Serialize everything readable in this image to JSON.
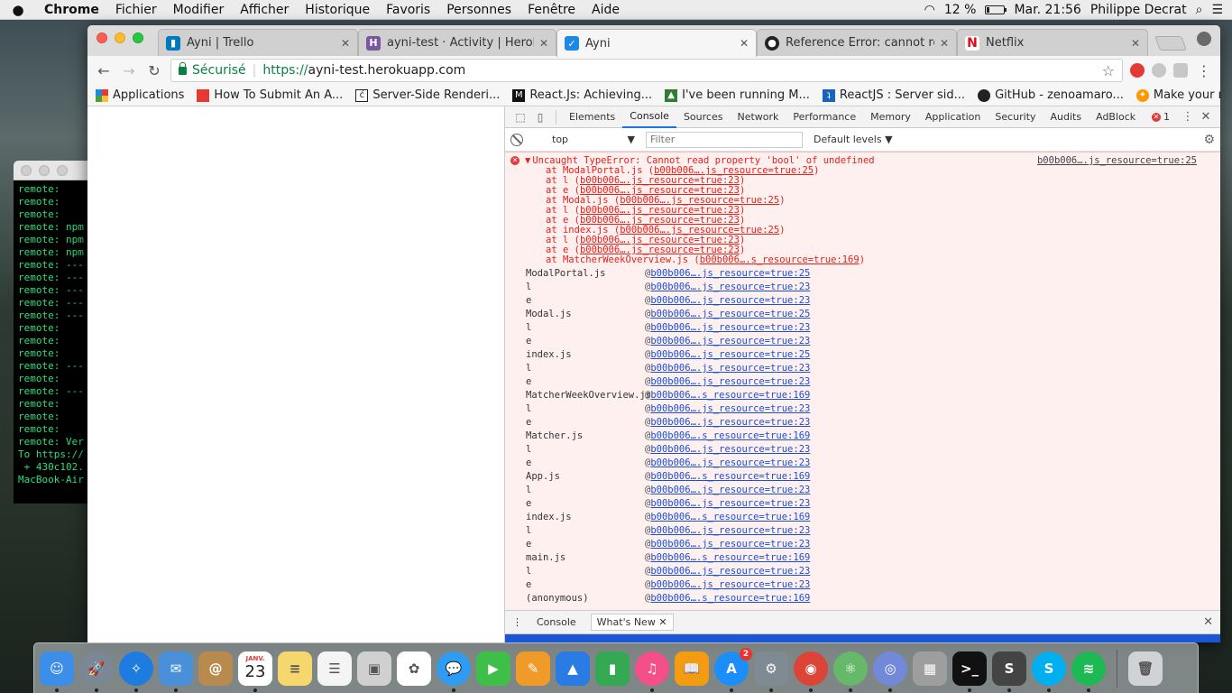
{
  "menubar": {
    "apple": "",
    "app_name": "Chrome",
    "items": [
      "Fichier",
      "Modifier",
      "Afficher",
      "Historique",
      "Favoris",
      "Personnes",
      "Fenêtre",
      "Aide"
    ],
    "battery_text": "12 %",
    "battery_level": 0.12,
    "clock": "Mar. 21:56",
    "user": "Philippe Decrat"
  },
  "terminal": {
    "lines": [
      "remote:  ",
      "remote:",
      "remote:",
      "remote: npm",
      "remote: npm",
      "remote: npm",
      "remote: ---",
      "remote: ---",
      "remote: ---",
      "remote: ---",
      "remote: ---",
      "remote:",
      "remote:",
      "remote:",
      "remote: ---",
      "remote:",
      "remote: ---",
      "remote:",
      "remote:",
      "remote:",
      "remote: Ver",
      "To https://",
      " + 430c102.",
      "MacBook-Air"
    ]
  },
  "tabs": [
    {
      "title": "Ayni | Trello",
      "icon": "trello-icon",
      "color": "#0079bf",
      "glyph": "▮"
    },
    {
      "title": "ayni-test · Activity | Heroku",
      "icon": "heroku-icon",
      "color": "#79589f",
      "glyph": "H"
    },
    {
      "title": "Ayni",
      "icon": "ayni-icon",
      "color": "#1e88e5",
      "glyph": "✓"
    },
    {
      "title": "Reference Error: cannot read",
      "icon": "github-icon",
      "color": "#222222",
      "glyph": "●"
    },
    {
      "title": "Netflix",
      "icon": "netflix-icon",
      "color": "#ffffff",
      "glyph": "N"
    }
  ],
  "address": {
    "secure_label": "Sécurisé",
    "scheme": "https://",
    "host": "ayni-test.herokuapp.com"
  },
  "bookmarks": [
    {
      "label": "Applications",
      "icon": "apps-grid-icon",
      "color": "#e53935",
      "glyph": "▦"
    },
    {
      "label": "How To Submit An A...",
      "icon": "bookmark-red-icon",
      "color": "#e53935",
      "glyph": "▯"
    },
    {
      "label": "Server-Side Renderi...",
      "icon": "bookmark-c-icon",
      "color": "#222222",
      "glyph": "ć"
    },
    {
      "label": "React.Js: Achieving...",
      "icon": "medium-icon",
      "color": "#111111",
      "glyph": "M"
    },
    {
      "label": "I've been running M...",
      "icon": "bookmark-green-icon",
      "color": "#2e7d32",
      "glyph": "▲"
    },
    {
      "label": "ReactJS : Server sid...",
      "icon": "bookmark-blue-icon",
      "color": "#1565c0",
      "glyph": "ʇ"
    },
    {
      "label": "GitHub - zenoamaro...",
      "icon": "github-icon",
      "color": "#222222",
      "glyph": "●"
    },
    {
      "label": "Make your meteo...",
      "icon": "bookmark-fire-icon",
      "color": "#ff9800",
      "glyph": "✦"
    }
  ],
  "bookmarks_more": "»",
  "devtools": {
    "tabs": [
      "Elements",
      "Console",
      "Sources",
      "Network",
      "Performance",
      "Memory",
      "Application",
      "Security",
      "Audits",
      "AdBlock"
    ],
    "active_tab": "Console",
    "error_count": "1",
    "context": "top",
    "filter_placeholder": "Filter",
    "levels": "Default levels",
    "error": {
      "message": "Uncaught TypeError: Cannot read property 'bool' of undefined",
      "source": "b00b006….js_resource=true:25",
      "frames": [
        {
          "prefix": "at ModalPortal.js (",
          "link": "b00b006….js_resource=true:25",
          "suffix": ")"
        },
        {
          "prefix": "at l (",
          "link": "b00b006….js_resource=true:23",
          "suffix": ")"
        },
        {
          "prefix": "at e (",
          "link": "b00b006….js_resource=true:23",
          "suffix": ")"
        },
        {
          "prefix": "at Modal.js (",
          "link": "b00b006….js_resource=true:25",
          "suffix": ")"
        },
        {
          "prefix": "at l (",
          "link": "b00b006….js_resource=true:23",
          "suffix": ")"
        },
        {
          "prefix": "at e (",
          "link": "b00b006….js_resource=true:23",
          "suffix": ")"
        },
        {
          "prefix": "at index.js (",
          "link": "b00b006….js_resource=true:25",
          "suffix": ")"
        },
        {
          "prefix": "at l (",
          "link": "b00b006….js_resource=true:23",
          "suffix": ")"
        },
        {
          "prefix": "at e (",
          "link": "b00b006….js_resource=true:23",
          "suffix": ")"
        },
        {
          "prefix": "at MatcherWeekOverview.js (",
          "link": "b00b006….s_resource=true:169",
          "suffix": ")"
        }
      ]
    },
    "stack": [
      {
        "fn": "ModalPortal.js",
        "loc": "b00b006….js_resource=true:25"
      },
      {
        "fn": "l",
        "loc": "b00b006….js_resource=true:23"
      },
      {
        "fn": "e",
        "loc": "b00b006….js_resource=true:23"
      },
      {
        "fn": "Modal.js",
        "loc": "b00b006….js_resource=true:25"
      },
      {
        "fn": "l",
        "loc": "b00b006….js_resource=true:23"
      },
      {
        "fn": "e",
        "loc": "b00b006….js_resource=true:23"
      },
      {
        "fn": "index.js",
        "loc": "b00b006….js_resource=true:25"
      },
      {
        "fn": "l",
        "loc": "b00b006….js_resource=true:23"
      },
      {
        "fn": "e",
        "loc": "b00b006….js_resource=true:23"
      },
      {
        "fn": "MatcherWeekOverview.js",
        "loc": "b00b006….s_resource=true:169"
      },
      {
        "fn": "l",
        "loc": "b00b006….js_resource=true:23"
      },
      {
        "fn": "e",
        "loc": "b00b006….js_resource=true:23"
      },
      {
        "fn": "Matcher.js",
        "loc": "b00b006….s_resource=true:169"
      },
      {
        "fn": "l",
        "loc": "b00b006….js_resource=true:23"
      },
      {
        "fn": "e",
        "loc": "b00b006….js_resource=true:23"
      },
      {
        "fn": "App.js",
        "loc": "b00b006….s_resource=true:169"
      },
      {
        "fn": "l",
        "loc": "b00b006….js_resource=true:23"
      },
      {
        "fn": "e",
        "loc": "b00b006….js_resource=true:23"
      },
      {
        "fn": "index.js",
        "loc": "b00b006….s_resource=true:169"
      },
      {
        "fn": "l",
        "loc": "b00b006….js_resource=true:23"
      },
      {
        "fn": "e",
        "loc": "b00b006….js_resource=true:23"
      },
      {
        "fn": "main.js",
        "loc": "b00b006….s_resource=true:169"
      },
      {
        "fn": "l",
        "loc": "b00b006….js_resource=true:23"
      },
      {
        "fn": "e",
        "loc": "b00b006….js_resource=true:23"
      },
      {
        "fn": "(anonymous)",
        "loc": "b00b006….s_resource=true:169"
      }
    ],
    "drawer_tabs": [
      "Console",
      "What's New"
    ],
    "drawer_active": "What's New"
  },
  "dock": {
    "calendar_month": "JANV.",
    "calendar_day": "23",
    "appstore_badge": "2",
    "apps": [
      {
        "name": "finder-icon",
        "color": "#3d8ee8",
        "glyph": "☺"
      },
      {
        "name": "launchpad-icon",
        "color": "#7b8794",
        "glyph": "🚀"
      },
      {
        "name": "safari-icon",
        "color": "#1e7be0",
        "glyph": "✧"
      },
      {
        "name": "mail-icon",
        "color": "#4a90d9",
        "glyph": "✉"
      },
      {
        "name": "contacts-icon",
        "color": "#b88a4e",
        "glyph": "@"
      },
      {
        "name": "calendar-icon",
        "color": "#ffffff",
        "glyph": ""
      },
      {
        "name": "notes-icon",
        "color": "#f5d76e",
        "glyph": "≡"
      },
      {
        "name": "reminders-icon",
        "color": "#f4f4f4",
        "glyph": "☰"
      },
      {
        "name": "photo-booth-icon",
        "color": "#d0d0d0",
        "glyph": "▣"
      },
      {
        "name": "photos-icon",
        "color": "#ffffff",
        "glyph": "✿"
      },
      {
        "name": "messages-icon",
        "color": "#2f9cf4",
        "glyph": "💬"
      },
      {
        "name": "facetime-icon",
        "color": "#3dbf4a",
        "glyph": "▶"
      },
      {
        "name": "pages-icon",
        "color": "#f09a2a",
        "glyph": "✎"
      },
      {
        "name": "keynote-icon",
        "color": "#2a7be4",
        "glyph": "▲"
      },
      {
        "name": "numbers-icon",
        "color": "#34a853",
        "glyph": "▮"
      },
      {
        "name": "itunes-icon",
        "color": "#f54f8a",
        "glyph": "♫"
      },
      {
        "name": "ibooks-icon",
        "color": "#f39c12",
        "glyph": "📖"
      },
      {
        "name": "app-store-icon",
        "color": "#1c8ef9",
        "glyph": "A"
      },
      {
        "name": "system-preferences-icon",
        "color": "#7f8a93",
        "glyph": "⚙"
      },
      {
        "name": "chrome-icon",
        "color": "#db4437",
        "glyph": "◉"
      },
      {
        "name": "atom-icon",
        "color": "#66b969",
        "glyph": "⚛"
      },
      {
        "name": "discord-icon",
        "color": "#7289da",
        "glyph": "◎"
      },
      {
        "name": "photo-icon",
        "color": "#9e9e9e",
        "glyph": "▦"
      },
      {
        "name": "terminal-icon",
        "color": "#111111",
        "glyph": ">_"
      },
      {
        "name": "sublime-icon",
        "color": "#444444",
        "glyph": "S"
      },
      {
        "name": "skype-icon",
        "color": "#00aff0",
        "glyph": "S"
      },
      {
        "name": "spotify-icon",
        "color": "#1db954",
        "glyph": "≋"
      }
    ],
    "trash": {
      "name": "trash-icon",
      "color": "#cfd3d6",
      "glyph": "🗑"
    }
  }
}
